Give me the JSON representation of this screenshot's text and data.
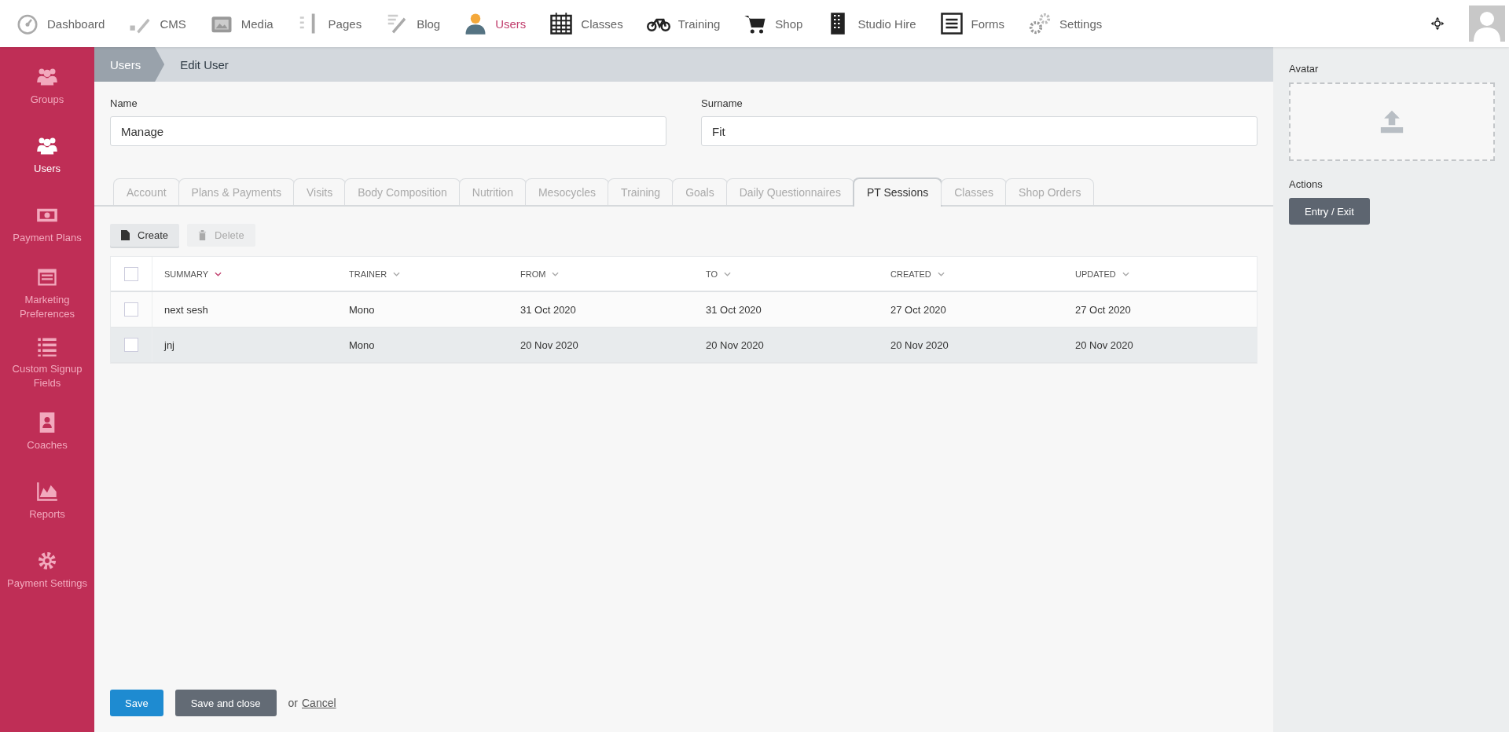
{
  "top_nav": [
    {
      "label": "Dashboard",
      "selected": false
    },
    {
      "label": "CMS",
      "selected": false
    },
    {
      "label": "Media",
      "selected": false
    },
    {
      "label": "Pages",
      "selected": false
    },
    {
      "label": "Blog",
      "selected": false
    },
    {
      "label": "Users",
      "selected": true
    },
    {
      "label": "Classes",
      "selected": false
    },
    {
      "label": "Training",
      "selected": false
    },
    {
      "label": "Shop",
      "selected": false
    },
    {
      "label": "Studio Hire",
      "selected": false
    },
    {
      "label": "Forms",
      "selected": false
    },
    {
      "label": "Settings",
      "selected": false
    }
  ],
  "sidebar": {
    "items": [
      {
        "label": "Groups",
        "selected": false
      },
      {
        "label": "Users",
        "selected": true
      },
      {
        "label": "Payment Plans",
        "selected": false
      },
      {
        "label": "Marketing Preferences",
        "selected": false
      },
      {
        "label": "Custom Signup Fields",
        "selected": false
      },
      {
        "label": "Coaches",
        "selected": false
      },
      {
        "label": "Reports",
        "selected": false
      },
      {
        "label": "Payment Settings",
        "selected": false
      }
    ]
  },
  "breadcrumb": [
    "Users",
    "Edit User"
  ],
  "fields": [
    {
      "label": "Name",
      "value": "Manage"
    },
    {
      "label": "Surname",
      "value": "Fit"
    }
  ],
  "tabs": [
    {
      "label": "Account",
      "selected": false
    },
    {
      "label": "Plans & Payments",
      "selected": false
    },
    {
      "label": "Visits",
      "selected": false
    },
    {
      "label": "Body Composition",
      "selected": false
    },
    {
      "label": "Nutrition",
      "selected": false
    },
    {
      "label": "Mesocycles",
      "selected": false
    },
    {
      "label": "Training",
      "selected": false
    },
    {
      "label": "Goals",
      "selected": false
    },
    {
      "label": "Daily Questionnaires",
      "selected": false
    },
    {
      "label": "PT Sessions",
      "selected": true
    },
    {
      "label": "Classes",
      "selected": false
    },
    {
      "label": "Shop Orders",
      "selected": false
    }
  ],
  "toolbar": [
    {
      "label": "Create",
      "disabled": false
    },
    {
      "label": "Delete",
      "disabled": true
    }
  ],
  "table": {
    "header_checked": false,
    "columns": [
      {
        "label": "SUMMARY",
        "sorted": true
      },
      {
        "label": "TRAINER",
        "sorted": false
      },
      {
        "label": "FROM",
        "sorted": false
      },
      {
        "label": "TO",
        "sorted": false
      },
      {
        "label": "CREATED",
        "sorted": false
      },
      {
        "label": "UPDATED",
        "sorted": false
      }
    ],
    "rows": [
      {
        "checked": false,
        "highlighted": false,
        "cells": [
          "next sesh",
          "Mono",
          "31 Oct 2020",
          "31 Oct 2020",
          "27 Oct 2020",
          "27 Oct 2020"
        ]
      },
      {
        "checked": false,
        "highlighted": true,
        "cells": [
          "jnj",
          "Mono",
          "20 Nov 2020",
          "20 Nov 2020",
          "20 Nov 2020",
          "20 Nov 2020"
        ]
      }
    ]
  },
  "footer": {
    "save": "Save",
    "save_close": "Save and close",
    "or": "or",
    "cancel": "Cancel"
  },
  "side_panel": {
    "avatar_label": "Avatar",
    "actions_label": "Actions",
    "action_button": "Entry / Exit"
  }
}
